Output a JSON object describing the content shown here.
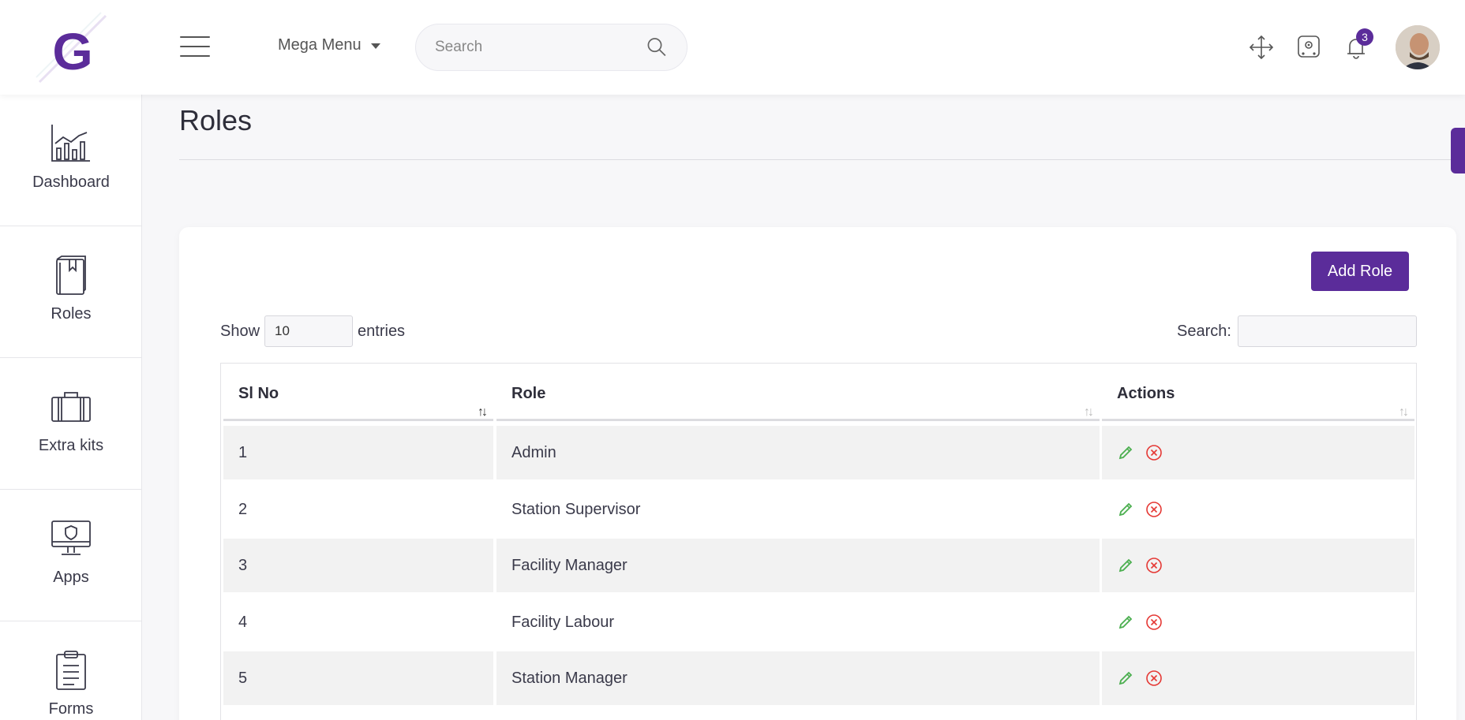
{
  "header": {
    "mega_menu_label": "Mega Menu",
    "search_placeholder": "Search",
    "notification_count": "3"
  },
  "sidebar": {
    "items": [
      {
        "label": "Dashboard",
        "icon": "chart-icon"
      },
      {
        "label": "Roles",
        "icon": "book-icon"
      },
      {
        "label": "Extra kits",
        "icon": "briefcase-icon"
      },
      {
        "label": "Apps",
        "icon": "monitor-shield-icon"
      },
      {
        "label": "Forms",
        "icon": "clipboard-icon"
      }
    ]
  },
  "page": {
    "title": "Roles",
    "add_button_label": "Add Role"
  },
  "table_controls": {
    "show_label": "Show",
    "entries_value": "10",
    "entries_label": "entries",
    "search_label": "Search:"
  },
  "table": {
    "columns": [
      "Sl No",
      "Role",
      "Actions"
    ],
    "rows": [
      {
        "sl": "1",
        "role": "Admin"
      },
      {
        "sl": "2",
        "role": "Station Supervisor"
      },
      {
        "sl": "3",
        "role": "Facility Manager"
      },
      {
        "sl": "4",
        "role": "Facility Labour"
      },
      {
        "sl": "5",
        "role": "Station Manager"
      }
    ]
  },
  "colors": {
    "accent": "#5b2c9a",
    "edit": "#4caf50",
    "delete": "#e53935"
  }
}
